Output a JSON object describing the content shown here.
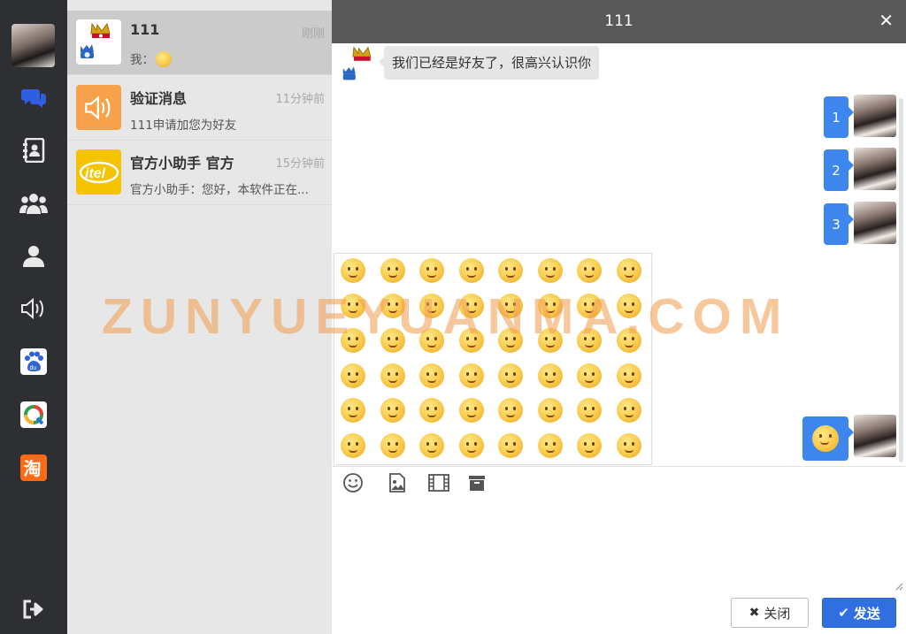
{
  "conversations": [
    {
      "name": "111",
      "time": "刚刚",
      "preview": "我：",
      "avatar": "crown-avatar-icon"
    },
    {
      "name": "验证消息",
      "time": "11分钟前",
      "preview": "111申请加您为好友",
      "avatar": "speaker-avatar-icon"
    },
    {
      "name": "官方小助手 官方",
      "time": "15分钟前",
      "preview": "官方小助手：您好，本软件正在...",
      "avatar": "itel-logo"
    }
  ],
  "chat": {
    "title": "111",
    "close_symbol": "✕",
    "incoming": {
      "text": "我们已经是好友了，很高兴认识你"
    },
    "outgoing": [
      {
        "text": "1"
      },
      {
        "text": "2"
      },
      {
        "text": "3"
      }
    ],
    "input_value": "",
    "close_button": "关闭",
    "send_button": "发送"
  },
  "sidebar_icons": [
    "chat-icon",
    "contacts-icon",
    "group-icon",
    "user-icon",
    "speaker-icon",
    "baidu-icon",
    "tencent-news-icon",
    "taobao-icon",
    "logout-icon"
  ],
  "toolbar_icons": [
    "emoji-icon",
    "image-icon",
    "video-icon",
    "file-icon"
  ],
  "watermark": "ZUNYUEYUANMA.COM",
  "colors": {
    "sidebar": "#2e2f33",
    "list_bg": "#e7e7e7",
    "header": "#595959",
    "bubble_out": "#3c86ee",
    "send_button": "#2f6fe0",
    "active_nav": "#2f6fe0"
  }
}
